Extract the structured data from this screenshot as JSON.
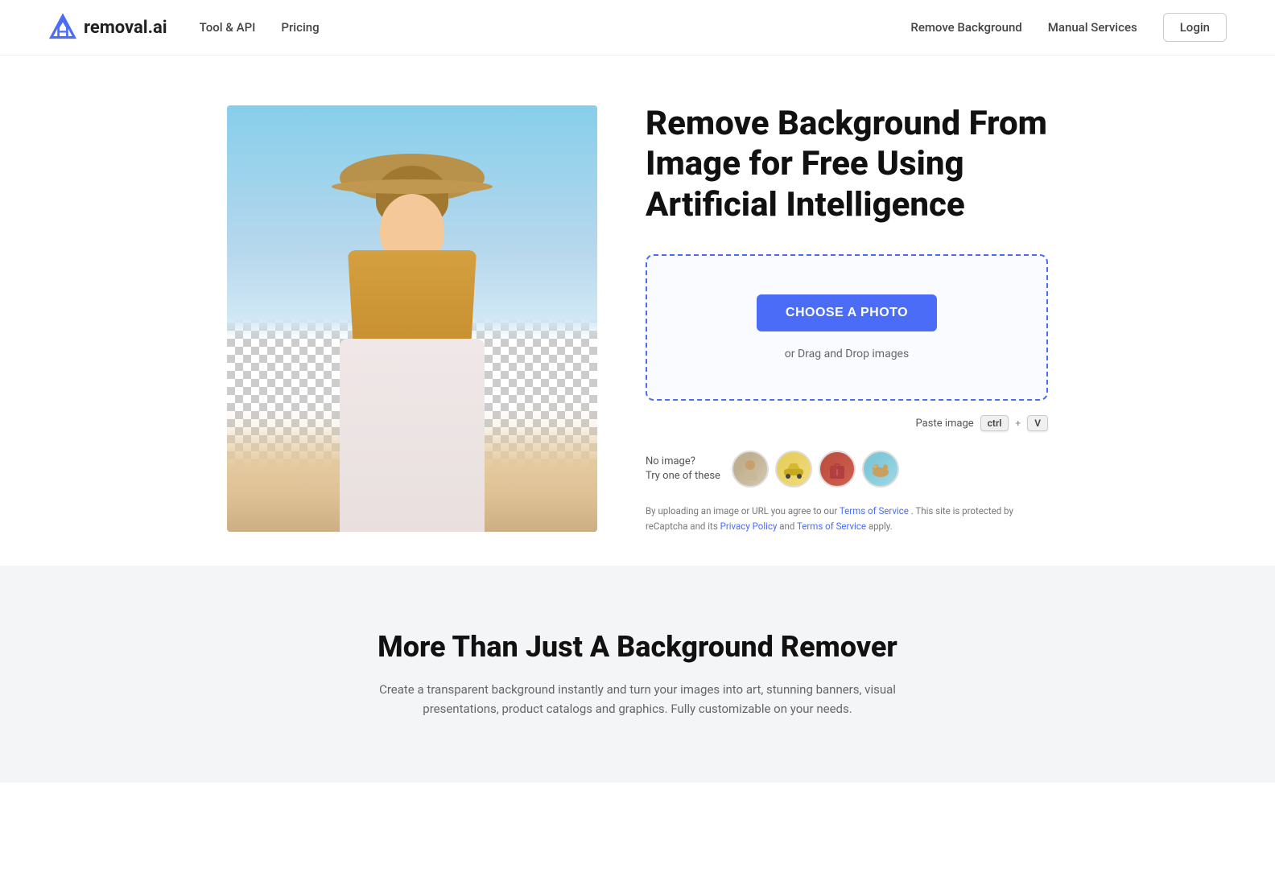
{
  "brand": {
    "name": "removal.ai",
    "logo_alt": "Removal.ai logo"
  },
  "nav": {
    "left_links": [
      {
        "label": "Tool & API",
        "href": "#"
      },
      {
        "label": "Pricing",
        "href": "#"
      }
    ],
    "right_links": [
      {
        "label": "Remove Background",
        "href": "#"
      },
      {
        "label": "Manual Services",
        "href": "#"
      },
      {
        "label": "Login",
        "href": "#"
      }
    ]
  },
  "hero": {
    "title": "Remove Background From Image for Free Using Artificial Intelligence",
    "upload": {
      "button_label": "CHOOSE A PHOTO",
      "drag_drop_text": "or Drag and Drop images"
    },
    "paste_hint": {
      "label": "Paste image",
      "key1": "ctrl",
      "plus": "+",
      "key2": "V"
    },
    "sample": {
      "no_image_line1": "No image?",
      "no_image_line2": "Try one of these",
      "thumbs": [
        {
          "label": "person sample",
          "type": "person"
        },
        {
          "label": "car sample",
          "type": "car"
        },
        {
          "label": "bag sample",
          "type": "bag"
        },
        {
          "label": "camel sample",
          "type": "camel"
        }
      ]
    },
    "terms": {
      "text1": "By uploading an image or URL you agree to our ",
      "terms_link1": "Terms of Service",
      "text2": " . This site is protected by reCaptcha and its ",
      "privacy_link": "Privacy Policy",
      "text3": " and ",
      "terms_link2": "Terms of Service",
      "text4": " apply."
    }
  },
  "bottom": {
    "title": "More Than Just A Background Remover",
    "description": "Create a transparent background instantly and turn your images into art, stunning banners, visual presentations, product catalogs and graphics. Fully customizable on your needs."
  }
}
